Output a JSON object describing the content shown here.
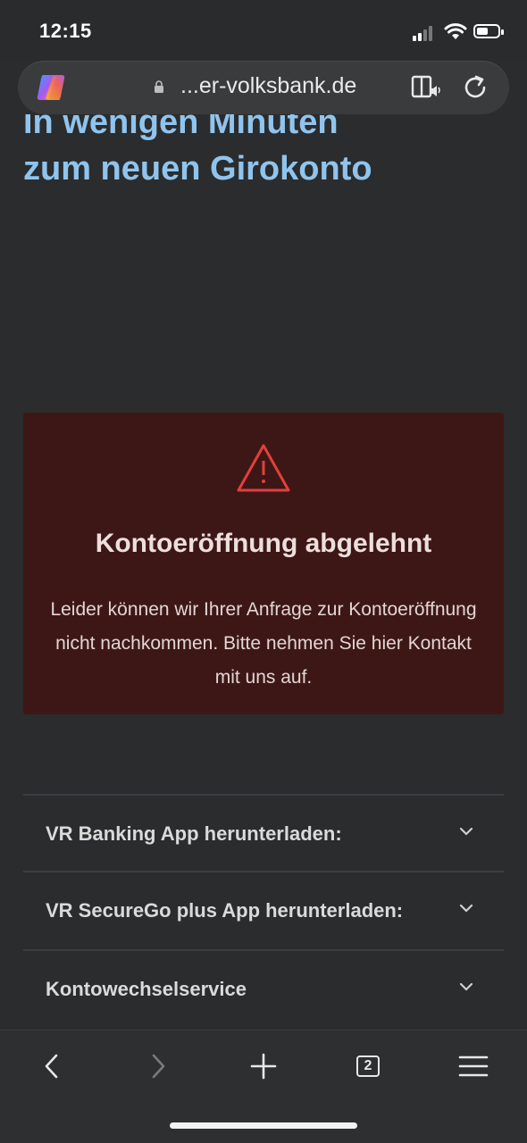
{
  "status": {
    "time": "12:15"
  },
  "browser": {
    "url": "...er-volksbank.de",
    "tab_count": "2"
  },
  "page": {
    "hero_line1": "In wenigen Minuten",
    "hero_line2": "zum neuen Girokonto",
    "error": {
      "title": "Kontoeröffnung abgelehnt",
      "text": "Leider können wir Ihrer Anfrage zur Kontoeröffnung nicht nachkommen. Bitte nehmen Sie hier Kontakt mit uns auf."
    },
    "accordion": [
      {
        "label": "VR Banking App herunterladen:"
      },
      {
        "label": "VR SecureGo plus App herunterladen:"
      },
      {
        "label": "Kontowechselservice"
      }
    ]
  },
  "colors": {
    "accent_link": "#8fc4ee",
    "error_bg": "#3d1716",
    "warning_icon": "#e0403c"
  },
  "icons": [
    "copilot-icon",
    "lock-icon",
    "reader-icon",
    "reload-icon",
    "warning-icon",
    "chevron-down-icon",
    "back-icon",
    "forward-icon",
    "plus-icon",
    "tabs-icon",
    "menu-icon"
  ]
}
